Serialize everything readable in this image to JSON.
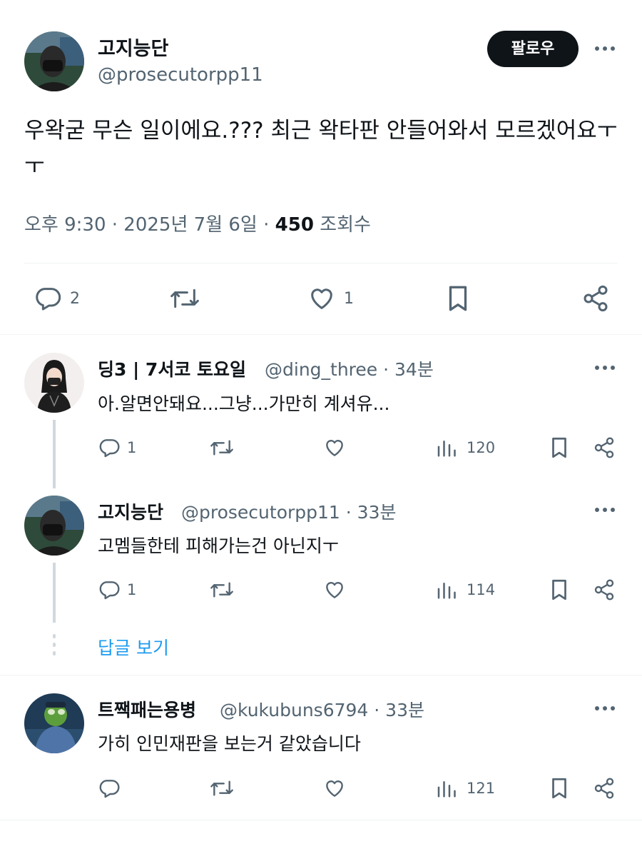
{
  "main_post": {
    "author_name": "고지능단",
    "author_handle": "@prosecutorpp11",
    "follow_label": "팔로우",
    "text": "우왁굳 무슨 일이에요.???  최근 왁타판 안들어와서 모르겠어요ㅜㅜ",
    "time": "오후 9:30",
    "date": "2025년 7월 6일",
    "views_count": "450",
    "views_label": "조회수",
    "reply_count": "2",
    "like_count": "1"
  },
  "replies": [
    {
      "name": "딩3 | 7서코 토요일",
      "handle": "@ding_three",
      "time": "34분",
      "text": "아.알면안돼요...그냥...가만히 계셔유...",
      "reply_count": "1",
      "views": "120"
    },
    {
      "name": "고지능단",
      "handle": "@prosecutorpp11",
      "time": "33분",
      "text": "고멤들한테 피해가는건 아닌지ㅜ",
      "reply_count": "1",
      "views": "114"
    },
    {
      "name": "트짹패는용병",
      "handle": "@kukubuns6794",
      "time": "33분",
      "text": "가히 인민재판을 보는거 같았습니다",
      "reply_count": "",
      "views": "121"
    }
  ],
  "thread": {
    "show_replies_label": "답글 보기"
  },
  "colors": {
    "text_primary": "#0f1419",
    "text_secondary": "#536471",
    "accent": "#1d9bf0",
    "divider": "#eff3f4",
    "follow_bg": "#0f1419"
  },
  "icons": {
    "reply": "reply-icon",
    "repost": "repost-icon",
    "like": "heart-icon",
    "views": "views-chart-icon",
    "bookmark": "bookmark-icon",
    "share": "share-icon",
    "more": "more-dots-icon"
  }
}
